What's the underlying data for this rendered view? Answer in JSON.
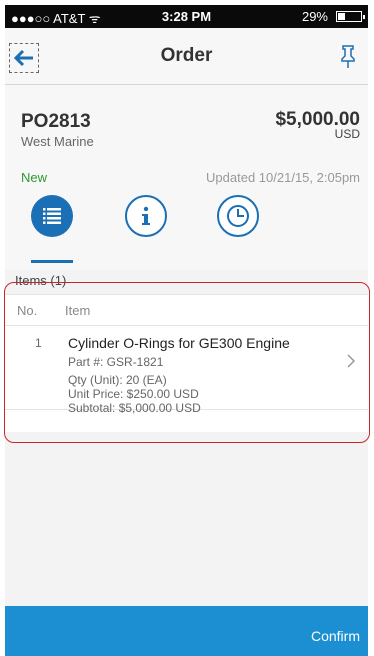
{
  "status_bar": {
    "carrier": "●●●○○ AT&T ᯤ",
    "time": "3:28 PM",
    "battery": "29%"
  },
  "nav": {
    "title": "Order",
    "back_icon": "arrow-left-icon",
    "pin_icon": "pushpin-icon"
  },
  "order": {
    "po_number": "PO2813",
    "vendor": "West Marine",
    "amount": "$5,000.00",
    "currency": "USD",
    "status": "New",
    "updated": "Updated 10/21/15, 2:05pm"
  },
  "tabs": [
    {
      "icon": "list-icon",
      "active": true
    },
    {
      "icon": "info-icon",
      "active": false
    },
    {
      "icon": "clock-icon",
      "active": false
    }
  ],
  "items_section": {
    "title": "Items (1)",
    "columns": [
      "No.",
      "Item"
    ],
    "rows": [
      {
        "no": "1",
        "name": "Cylinder O-Rings for GE300 Engine",
        "part": "Part #: GSR-1821",
        "qty": "Qty (Unit): 20 (EA)",
        "unit_price": "Unit Price: $250.00 USD",
        "subtotal": "Subtotal: $5,000.00 USD"
      }
    ]
  },
  "footer": {
    "confirm_label": "Confirm"
  },
  "colors": {
    "accent": "#1b6fb4",
    "footer": "#1b8fd1",
    "status_new": "#2f9a2f",
    "highlight": "#c8262e"
  }
}
